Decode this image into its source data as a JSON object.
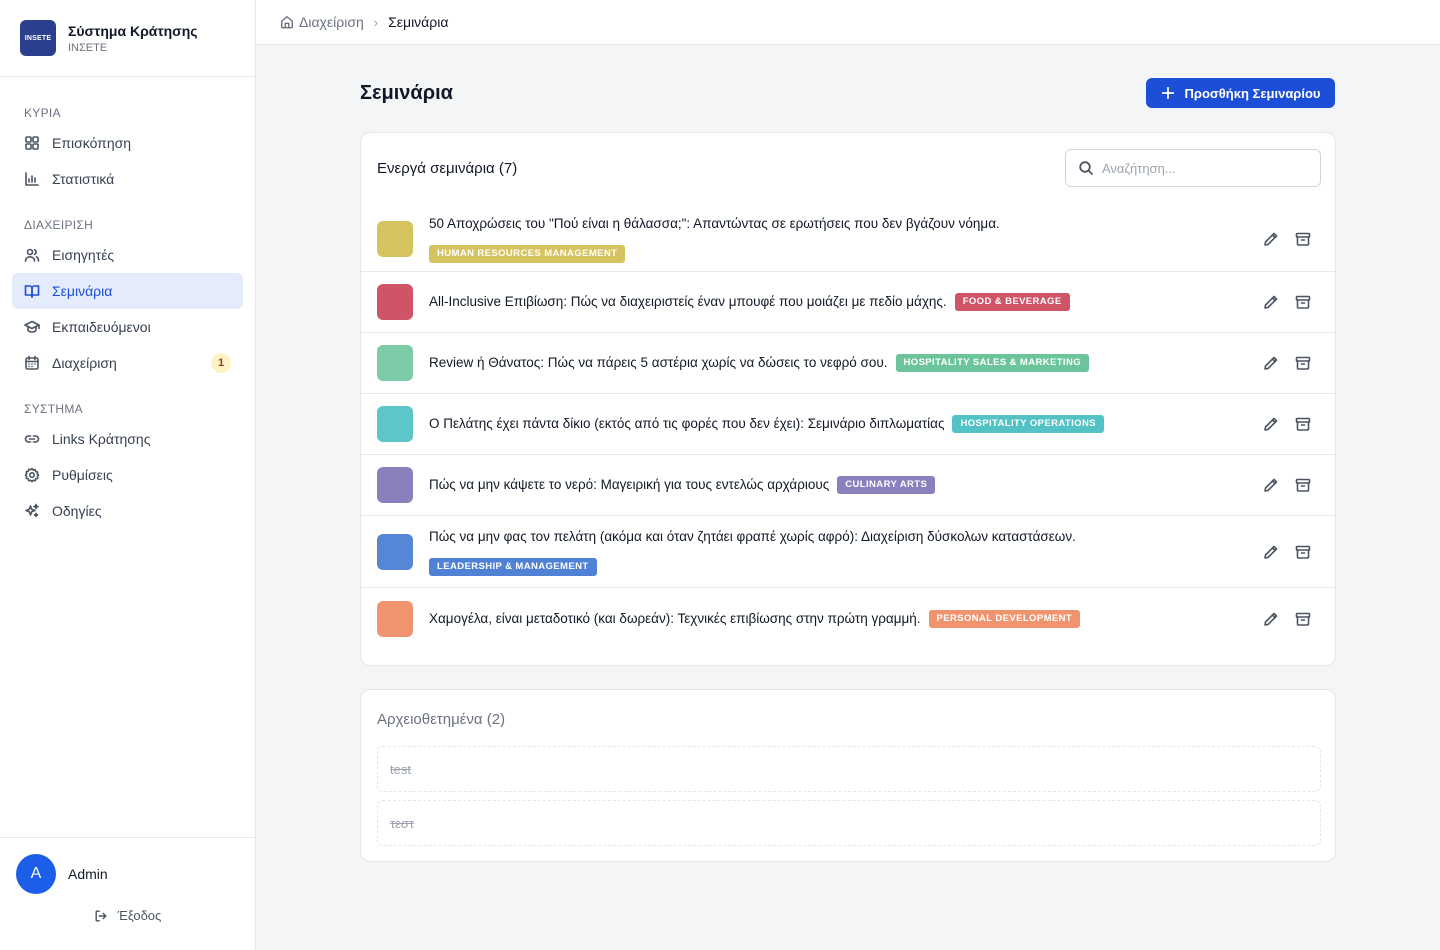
{
  "brand": {
    "logo_text": "INSETE",
    "title": "Σύστημα Κράτησης",
    "subtitle": "ΙΝΣΕΤΕ"
  },
  "sidebar": {
    "sections": [
      {
        "label": "ΚΥΡΙΑ",
        "items": [
          {
            "label": "Επισκόπηση",
            "icon": "grid-icon"
          },
          {
            "label": "Στατιστικά",
            "icon": "bar-chart-icon"
          }
        ]
      },
      {
        "label": "ΔΙΑΧΕΙΡΙΣΗ",
        "items": [
          {
            "label": "Εισηγητές",
            "icon": "users-icon"
          },
          {
            "label": "Σεμινάρια",
            "icon": "book-open-icon",
            "active": true
          },
          {
            "label": "Εκπαιδευόμενοι",
            "icon": "graduation-cap-icon"
          },
          {
            "label": "Διαχείριση",
            "icon": "calendar-icon",
            "badge": "1"
          }
        ]
      },
      {
        "label": "ΣΥΣΤΗΜΑ",
        "items": [
          {
            "label": "Links Κράτησης",
            "icon": "link-icon"
          },
          {
            "label": "Ρυθμίσεις",
            "icon": "gear-icon"
          },
          {
            "label": "Οδηγίες",
            "icon": "sparkles-icon"
          }
        ]
      }
    ]
  },
  "user": {
    "initial": "A",
    "name": "Admin",
    "logout_label": "Έξοδος"
  },
  "breadcrumb": {
    "home": "Διαχείριση",
    "current": "Σεμινάρια"
  },
  "page": {
    "title": "Σεμινάρια",
    "add_button": "Προσθήκη Σεμιναρίου"
  },
  "active_card": {
    "title": "Ενεργά σεμινάρια (7)",
    "search_placeholder": "Αναζήτηση...",
    "seminars": [
      {
        "title": "50 Αποχρώσεις του \"Πού είναι η θάλασσα;\": Απαντώντας σε ερωτήσεις που δεν βγάζουν νόημα.",
        "tag": "HUMAN RESOURCES MANAGEMENT",
        "color": "#d6c35f",
        "tag_color": "#d6c35f",
        "wrap": true
      },
      {
        "title": "All-Inclusive Επιβίωση: Πώς να διαχειριστείς έναν μπουφέ που μοιάζει με πεδίο μάχης.",
        "tag": "FOOD & BEVERAGE",
        "color": "#cf5468",
        "tag_color": "#cf5468",
        "wrap": false
      },
      {
        "title": "Review ή Θάνατος: Πώς να πάρεις 5 αστέρια χωρίς να δώσεις το νεφρό σου.",
        "tag": "HOSPITALITY SALES & MARKETING",
        "color": "#7ccaa6",
        "tag_color": "#6cc49c",
        "wrap": false
      },
      {
        "title": "Ο Πελάτης έχει πάντα δίκιο (εκτός από τις φορές που δεν έχει): Σεμινάριο διπλωματίας",
        "tag": "HOSPITALITY OPERATIONS",
        "color": "#5cc6c8",
        "tag_color": "#52c2c4",
        "wrap": false
      },
      {
        "title": "Πώς να μην κάψετε το νερό: Μαγειρική για τους εντελώς αρχάριους",
        "tag": "CULINARY ARTS",
        "color": "#8b80bc",
        "tag_color": "#8b7fbd",
        "wrap": false
      },
      {
        "title": "Πώς να μην φας τον πελάτη (ακόμα και όταν ζητάει φραπέ χωρίς αφρό): Διαχείριση δύσκολων καταστάσεων.",
        "tag": "LEADERSHIP & MANAGEMENT",
        "color": "#5587d6",
        "tag_color": "#4f82d4",
        "wrap": true
      },
      {
        "title": "Χαμογέλα, είναι μεταδοτικό (και δωρεάν): Τεχνικές επιβίωσης στην πρώτη γραμμή.",
        "tag": "PERSONAL DEVELOPMENT",
        "color": "#f09470",
        "tag_color": "#f09470",
        "wrap": false
      }
    ]
  },
  "archived_card": {
    "title": "Αρχειοθετημένα (2)",
    "items": [
      "test",
      "τεστ"
    ]
  },
  "colors": {
    "accent": "#1d4ed8",
    "active_bg": "#e4ebfb"
  }
}
